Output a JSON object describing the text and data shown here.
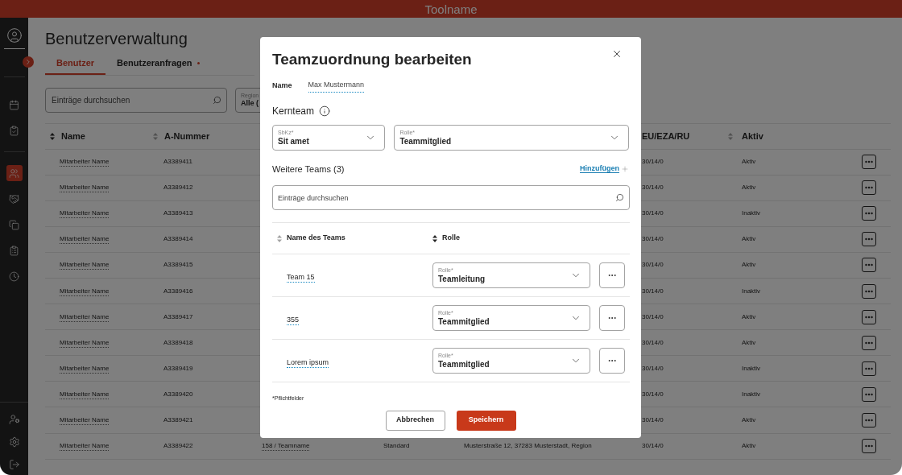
{
  "app_bar": {
    "title": "Toolname"
  },
  "sidebar": {
    "nav_items": [
      {
        "selected": false
      },
      {
        "selected": false
      },
      {
        "selected": true
      },
      {
        "selected": false
      },
      {
        "selected": false
      },
      {
        "selected": false
      },
      {
        "selected": false
      }
    ]
  },
  "page": {
    "title": "Benutzerverwaltung",
    "tabs": [
      {
        "label": "Benutzer",
        "selected": true,
        "dot": false
      },
      {
        "label": "Benutzeranfragen",
        "selected": false,
        "dot": true
      }
    ],
    "search": {
      "placeholder": "Einträge durchsuchen"
    },
    "region_filter": {
      "label": "Region",
      "value": "Alle ("
    },
    "table": {
      "headers": {
        "name": {
          "label": "Name",
          "sorted": true
        },
        "a_nummer": {
          "label": "A-Nummer",
          "sorted": false
        },
        "eu_eza_ru": {
          "label": "EU/EZA/RU"
        },
        "aktiv": {
          "label": "Aktiv",
          "sorted": false
        }
      },
      "rows": [
        {
          "name": "Mitarbeiter Name",
          "a_nummer": "A3389411",
          "eu_eza_ru": "30/14/0",
          "status": "Aktiv"
        },
        {
          "name": "Mitarbeiter Name",
          "a_nummer": "A3389412",
          "eu_eza_ru": "30/14/0",
          "status": "Aktiv"
        },
        {
          "name": "Mitarbeiter Name",
          "a_nummer": "A3389413",
          "eu_eza_ru": "30/14/0",
          "status": "Inaktiv"
        },
        {
          "name": "Mitarbeiter Name",
          "a_nummer": "A3389414",
          "eu_eza_ru": "30/14/0",
          "status": "Aktiv"
        },
        {
          "name": "Mitarbeiter Name",
          "a_nummer": "A3389415",
          "eu_eza_ru": "30/14/0",
          "status": "Aktiv"
        },
        {
          "name": "Mitarbeiter Name",
          "a_nummer": "A3389416",
          "eu_eza_ru": "30/14/0",
          "status": "Inaktiv"
        },
        {
          "name": "Mitarbeiter Name",
          "a_nummer": "A3389417",
          "eu_eza_ru": "30/14/0",
          "status": "Aktiv"
        },
        {
          "name": "Mitarbeiter Name",
          "a_nummer": "A3389418",
          "eu_eza_ru": "30/14/0",
          "status": "Aktiv"
        },
        {
          "name": "Mitarbeiter Name",
          "a_nummer": "A3389419",
          "eu_eza_ru": "30/14/0",
          "status": "Inaktiv"
        },
        {
          "name": "Mitarbeiter Name",
          "a_nummer": "A3389420",
          "eu_eza_ru": "30/14/0",
          "status": "Inaktiv"
        },
        {
          "name": "Mitarbeiter Name",
          "a_nummer": "A3389421",
          "eu_eza_ru": "30/14/0",
          "status": "Aktiv"
        },
        {
          "name": "Mitarbeiter Name",
          "a_nummer": "A3389422",
          "team": "158 / Teamname",
          "typ": "Standard",
          "adresse": "Musterstraße 12, 37283 Musterstadt, Region",
          "eu_eza_ru": "30/14/0",
          "status": "Aktiv"
        }
      ]
    }
  },
  "dialog": {
    "title": "Teamzuordnung bearbeiten",
    "name_label": "Name",
    "name_value": "Max Mustermann",
    "core_team": {
      "title": "Kernteam",
      "sbkz": {
        "label": "SbKz*",
        "value": "Sit amet"
      },
      "rolle": {
        "label": "Rolle*",
        "value": "Teammitglied"
      }
    },
    "other_teams": {
      "title": "Weitere Teams (3)",
      "add_link": "Hinzufügen",
      "search": {
        "placeholder": "Einträge durchsuchen"
      },
      "headers": [
        {
          "label": "Name des Teams",
          "sorted": false
        },
        {
          "label": "Rolle",
          "sorted": true
        }
      ],
      "rows": [
        {
          "team": "Team 15",
          "role_label": "Rolle*",
          "role": "Teamleitung"
        },
        {
          "team": "355",
          "role_label": "Rolle*",
          "role": "Teammitglied"
        },
        {
          "team": "Lorem ipsum",
          "role_label": "Rolle*",
          "role": "Teammitglied"
        }
      ]
    },
    "footnote": "*Pflichtfelder",
    "buttons": {
      "cancel": "Abbrechen",
      "save": "Speichern"
    }
  }
}
